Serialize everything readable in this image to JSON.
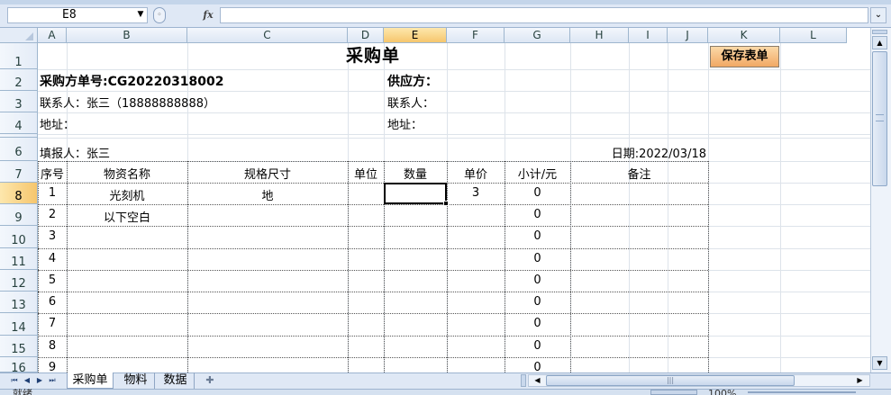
{
  "formula_bar": {
    "name_box": "E8",
    "fx_label": "fx",
    "formula_value": "",
    "expand_glyph": "⌄"
  },
  "columns": [
    "A",
    "B",
    "C",
    "D",
    "E",
    "F",
    "G",
    "H",
    "I",
    "J",
    "K",
    "L"
  ],
  "selected_column": "E",
  "rows": [
    "1",
    "2",
    "3",
    "4",
    "5",
    "6",
    "7",
    "8",
    "9",
    "10",
    "11",
    "12",
    "13",
    "14",
    "15",
    "16"
  ],
  "selected_row": "8",
  "sheet": {
    "title": "采购单",
    "save_button": "保存表单",
    "order_no": "采购方单号:CG20220318002",
    "contact_left": "联系人：张三（18888888888）",
    "address_left": "地址：",
    "supplier": "供应方：",
    "contact_right": "联系人：",
    "address_right": "地址：",
    "filler": "填报人：张三",
    "date": "日期:2022/03/18",
    "headers": [
      "序号",
      "物资名称",
      "规格尺寸",
      "单位",
      "数量",
      "单价",
      "小计/元",
      "备注"
    ],
    "items": [
      {
        "no": "1",
        "name": "光刻机",
        "spec": "地",
        "unit": "",
        "qty": "",
        "price": "3",
        "subtotal": "0",
        "note": ""
      },
      {
        "no": "2",
        "name": "以下空白",
        "spec": "",
        "unit": "",
        "qty": "",
        "price": "",
        "subtotal": "0",
        "note": ""
      },
      {
        "no": "3",
        "name": "",
        "spec": "",
        "unit": "",
        "qty": "",
        "price": "",
        "subtotal": "0",
        "note": ""
      },
      {
        "no": "4",
        "name": "",
        "spec": "",
        "unit": "",
        "qty": "",
        "price": "",
        "subtotal": "0",
        "note": ""
      },
      {
        "no": "5",
        "name": "",
        "spec": "",
        "unit": "",
        "qty": "",
        "price": "",
        "subtotal": "0",
        "note": ""
      },
      {
        "no": "6",
        "name": "",
        "spec": "",
        "unit": "",
        "qty": "",
        "price": "",
        "subtotal": "0",
        "note": ""
      },
      {
        "no": "7",
        "name": "",
        "spec": "",
        "unit": "",
        "qty": "",
        "price": "",
        "subtotal": "0",
        "note": ""
      },
      {
        "no": "8",
        "name": "",
        "spec": "",
        "unit": "",
        "qty": "",
        "price": "",
        "subtotal": "0",
        "note": ""
      },
      {
        "no": "9",
        "name": "",
        "spec": "",
        "unit": "",
        "qty": "",
        "price": "",
        "subtotal": "0",
        "note": ""
      }
    ]
  },
  "tabs": {
    "nav": [
      "⏮",
      "◀",
      "▶",
      "⏭"
    ],
    "active": "采购单",
    "tab2": "物料",
    "tab3": "数据",
    "new_tab": "✚"
  },
  "status": {
    "text": "就绪",
    "zoom": "100%"
  },
  "colors": {
    "save_button_bg": "#f1a864",
    "header_selected": "#f6c66d",
    "grid": "#dde3ea"
  }
}
